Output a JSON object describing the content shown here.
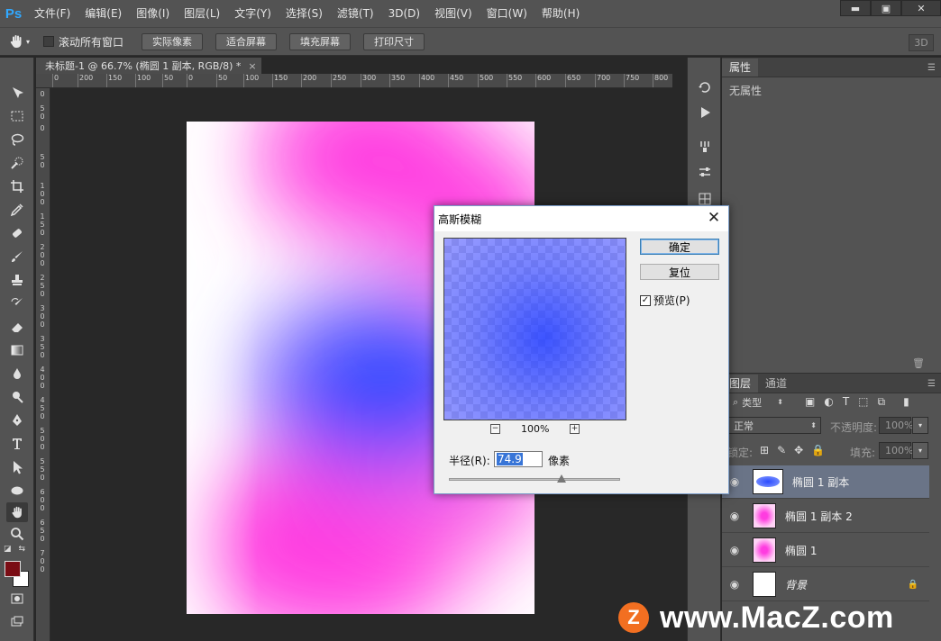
{
  "app": {
    "logo": "Ps"
  },
  "menu": [
    "文件(F)",
    "编辑(E)",
    "图像(I)",
    "图层(L)",
    "文字(Y)",
    "选择(S)",
    "滤镜(T)",
    "3D(D)",
    "视图(V)",
    "窗口(W)",
    "帮助(H)"
  ],
  "window_controls": {
    "minimize": "▬",
    "maximize": "▣",
    "close": "✕"
  },
  "options": {
    "scroll_all_label": "滚动所有窗口",
    "actual_pixels": "实际像素",
    "fit_screen": "适合屏幕",
    "fill_screen": "填充屏幕",
    "print_size": "打印尺寸",
    "mode_3d": "3D"
  },
  "document": {
    "tab_title": "未标题-1 @ 66.7% (椭圆 1 副本, RGB/8) *",
    "tab_close": "×",
    "ruler_top": [
      "0",
      "200",
      "150",
      "100",
      "50",
      "0",
      "50",
      "100",
      "150",
      "200",
      "250",
      "300",
      "350",
      "400",
      "450",
      "500",
      "550",
      "600",
      "650",
      "700",
      "750",
      "800"
    ],
    "ruler_left": [
      "0",
      "5 0",
      "0",
      "5 0",
      "1 0 0",
      "1 5 0",
      "2 0 0",
      "2 5 0",
      "3 0 0",
      "3 5 0",
      "4 0 0",
      "4 5 0",
      "5 0 0",
      "5 5 0",
      "6 0 0",
      "6 5 0",
      "7 0 0"
    ],
    "gradient_colors": {
      "magenta": "#ff3ce0",
      "blue": "#2b4bff",
      "white": "#ffffff"
    }
  },
  "properties_panel": {
    "tab": "属性",
    "empty_text": "无属性"
  },
  "layers_panel": {
    "tabs": [
      "图层",
      "通道"
    ],
    "filter_kind": "类型",
    "blend_mode": "正常",
    "opacity_label": "不透明度:",
    "opacity_value": "100%",
    "lock_label": "锁定:",
    "fill_label": "填充:",
    "fill_value": "100%",
    "layers": [
      {
        "name": "椭圆 1 副本",
        "selected": true
      },
      {
        "name": "椭圆 1 副本 2",
        "selected": false
      },
      {
        "name": "椭圆 1",
        "selected": false
      },
      {
        "name": "背景",
        "selected": false
      }
    ]
  },
  "dialog": {
    "title": "高斯模糊",
    "close": "✕",
    "ok": "确定",
    "reset": "复位",
    "preview_label": "预览(P)",
    "preview_checked": true,
    "zoom": "100%",
    "zoom_out": "−",
    "zoom_in": "+",
    "radius_label": "半径(R):",
    "radius_value": "74.9",
    "radius_unit": "像素",
    "radius_slider_fraction": 0.66
  },
  "watermark": {
    "logo_letter": "Z",
    "text": "www.MacZ.com"
  },
  "colors": {
    "foreground": "#7a0c14",
    "background": "#ffffff",
    "accent_selected_layer": "#6a7487"
  }
}
